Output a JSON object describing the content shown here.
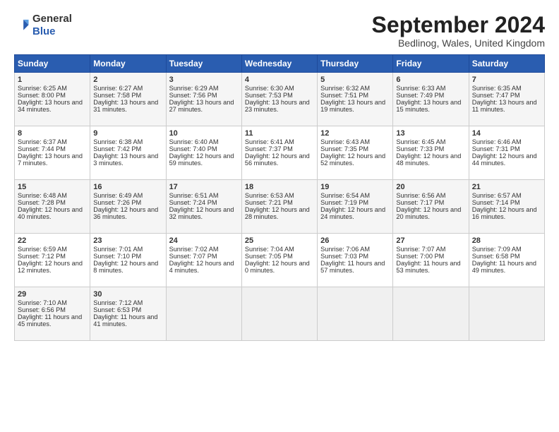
{
  "logo": {
    "text_general": "General",
    "text_blue": "Blue"
  },
  "title": "September 2024",
  "subtitle": "Bedlinog, Wales, United Kingdom",
  "headers": [
    "Sunday",
    "Monday",
    "Tuesday",
    "Wednesday",
    "Thursday",
    "Friday",
    "Saturday"
  ],
  "weeks": [
    [
      {
        "day": "1",
        "rise": "Sunrise: 6:25 AM",
        "set": "Sunset: 8:00 PM",
        "daylight": "Daylight: 13 hours and 34 minutes."
      },
      {
        "day": "2",
        "rise": "Sunrise: 6:27 AM",
        "set": "Sunset: 7:58 PM",
        "daylight": "Daylight: 13 hours and 31 minutes."
      },
      {
        "day": "3",
        "rise": "Sunrise: 6:29 AM",
        "set": "Sunset: 7:56 PM",
        "daylight": "Daylight: 13 hours and 27 minutes."
      },
      {
        "day": "4",
        "rise": "Sunrise: 6:30 AM",
        "set": "Sunset: 7:53 PM",
        "daylight": "Daylight: 13 hours and 23 minutes."
      },
      {
        "day": "5",
        "rise": "Sunrise: 6:32 AM",
        "set": "Sunset: 7:51 PM",
        "daylight": "Daylight: 13 hours and 19 minutes."
      },
      {
        "day": "6",
        "rise": "Sunrise: 6:33 AM",
        "set": "Sunset: 7:49 PM",
        "daylight": "Daylight: 13 hours and 15 minutes."
      },
      {
        "day": "7",
        "rise": "Sunrise: 6:35 AM",
        "set": "Sunset: 7:47 PM",
        "daylight": "Daylight: 13 hours and 11 minutes."
      }
    ],
    [
      {
        "day": "8",
        "rise": "Sunrise: 6:37 AM",
        "set": "Sunset: 7:44 PM",
        "daylight": "Daylight: 13 hours and 7 minutes."
      },
      {
        "day": "9",
        "rise": "Sunrise: 6:38 AM",
        "set": "Sunset: 7:42 PM",
        "daylight": "Daylight: 13 hours and 3 minutes."
      },
      {
        "day": "10",
        "rise": "Sunrise: 6:40 AM",
        "set": "Sunset: 7:40 PM",
        "daylight": "Daylight: 12 hours and 59 minutes."
      },
      {
        "day": "11",
        "rise": "Sunrise: 6:41 AM",
        "set": "Sunset: 7:37 PM",
        "daylight": "Daylight: 12 hours and 56 minutes."
      },
      {
        "day": "12",
        "rise": "Sunrise: 6:43 AM",
        "set": "Sunset: 7:35 PM",
        "daylight": "Daylight: 12 hours and 52 minutes."
      },
      {
        "day": "13",
        "rise": "Sunrise: 6:45 AM",
        "set": "Sunset: 7:33 PM",
        "daylight": "Daylight: 12 hours and 48 minutes."
      },
      {
        "day": "14",
        "rise": "Sunrise: 6:46 AM",
        "set": "Sunset: 7:31 PM",
        "daylight": "Daylight: 12 hours and 44 minutes."
      }
    ],
    [
      {
        "day": "15",
        "rise": "Sunrise: 6:48 AM",
        "set": "Sunset: 7:28 PM",
        "daylight": "Daylight: 12 hours and 40 minutes."
      },
      {
        "day": "16",
        "rise": "Sunrise: 6:49 AM",
        "set": "Sunset: 7:26 PM",
        "daylight": "Daylight: 12 hours and 36 minutes."
      },
      {
        "day": "17",
        "rise": "Sunrise: 6:51 AM",
        "set": "Sunset: 7:24 PM",
        "daylight": "Daylight: 12 hours and 32 minutes."
      },
      {
        "day": "18",
        "rise": "Sunrise: 6:53 AM",
        "set": "Sunset: 7:21 PM",
        "daylight": "Daylight: 12 hours and 28 minutes."
      },
      {
        "day": "19",
        "rise": "Sunrise: 6:54 AM",
        "set": "Sunset: 7:19 PM",
        "daylight": "Daylight: 12 hours and 24 minutes."
      },
      {
        "day": "20",
        "rise": "Sunrise: 6:56 AM",
        "set": "Sunset: 7:17 PM",
        "daylight": "Daylight: 12 hours and 20 minutes."
      },
      {
        "day": "21",
        "rise": "Sunrise: 6:57 AM",
        "set": "Sunset: 7:14 PM",
        "daylight": "Daylight: 12 hours and 16 minutes."
      }
    ],
    [
      {
        "day": "22",
        "rise": "Sunrise: 6:59 AM",
        "set": "Sunset: 7:12 PM",
        "daylight": "Daylight: 12 hours and 12 minutes."
      },
      {
        "day": "23",
        "rise": "Sunrise: 7:01 AM",
        "set": "Sunset: 7:10 PM",
        "daylight": "Daylight: 12 hours and 8 minutes."
      },
      {
        "day": "24",
        "rise": "Sunrise: 7:02 AM",
        "set": "Sunset: 7:07 PM",
        "daylight": "Daylight: 12 hours and 4 minutes."
      },
      {
        "day": "25",
        "rise": "Sunrise: 7:04 AM",
        "set": "Sunset: 7:05 PM",
        "daylight": "Daylight: 12 hours and 0 minutes."
      },
      {
        "day": "26",
        "rise": "Sunrise: 7:06 AM",
        "set": "Sunset: 7:03 PM",
        "daylight": "Daylight: 11 hours and 57 minutes."
      },
      {
        "day": "27",
        "rise": "Sunrise: 7:07 AM",
        "set": "Sunset: 7:00 PM",
        "daylight": "Daylight: 11 hours and 53 minutes."
      },
      {
        "day": "28",
        "rise": "Sunrise: 7:09 AM",
        "set": "Sunset: 6:58 PM",
        "daylight": "Daylight: 11 hours and 49 minutes."
      }
    ],
    [
      {
        "day": "29",
        "rise": "Sunrise: 7:10 AM",
        "set": "Sunset: 6:56 PM",
        "daylight": "Daylight: 11 hours and 45 minutes."
      },
      {
        "day": "30",
        "rise": "Sunrise: 7:12 AM",
        "set": "Sunset: 6:53 PM",
        "daylight": "Daylight: 11 hours and 41 minutes."
      },
      null,
      null,
      null,
      null,
      null
    ]
  ]
}
